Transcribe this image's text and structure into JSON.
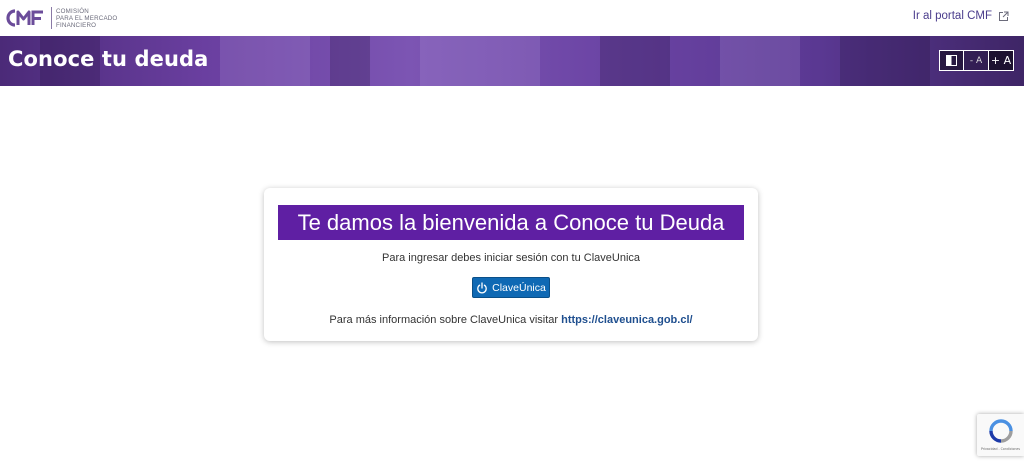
{
  "header": {
    "logo_lines": [
      "COMISIÓN",
      "PARA EL MERCADO",
      "FINANCIERO"
    ],
    "portal_link": "Ir al portal CMF"
  },
  "banner": {
    "title": "Conoce tu deuda",
    "a11y": {
      "minus": "- A",
      "plus": "+ A"
    }
  },
  "card": {
    "title": "Te damos la bienvenida a Conoce tu Deuda",
    "message": "Para ingresar debes iniciar sesión con tu ClaveUnica",
    "button_label": "ClaveÚnica",
    "info_prefix": "Para más información sobre ClaveUnica visitar",
    "info_link": "https://claveunica.gob.cl/"
  },
  "recaptcha": {
    "text": "Privacidad - Condiciones"
  },
  "colors": {
    "brand_purple": "#5f1fa3",
    "clave_blue": "#0f69b4",
    "link_blue": "#1f4f8f"
  },
  "icons": [
    "cmf-logo",
    "external-link-icon",
    "contrast-icon",
    "power-icon",
    "recaptcha-icon"
  ]
}
